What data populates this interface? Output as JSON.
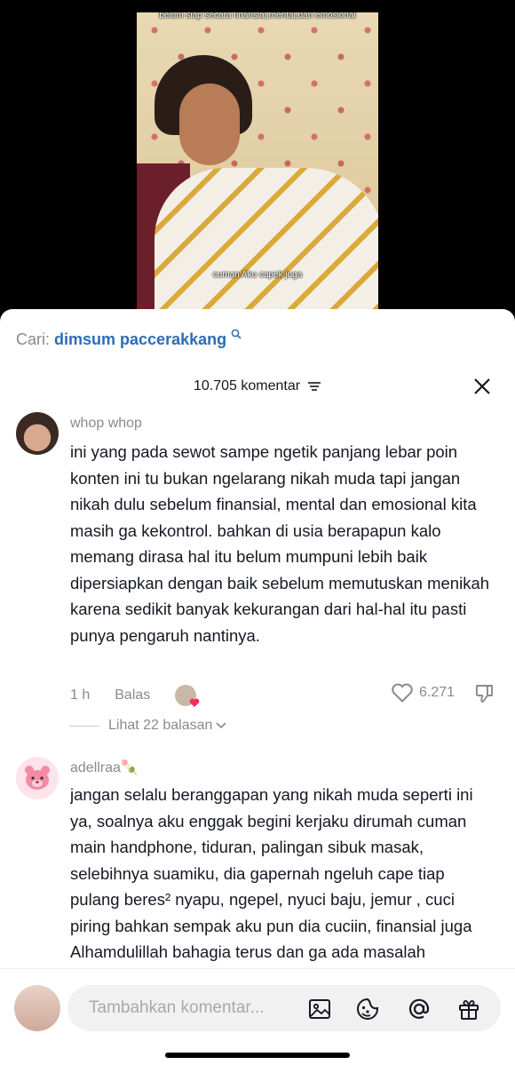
{
  "video": {
    "caption_top": "belum siap secara finansial,mental,dan emosional",
    "caption_bottom": "cuman Aku capek juga"
  },
  "search": {
    "prefix": "Cari: ",
    "term": "dimsum paccerakkang"
  },
  "header": {
    "count_label": "10.705 komentar"
  },
  "comments": [
    {
      "user": "whop whop",
      "text": "ini yang pada sewot sampe ngetik panjang lebar poin konten ini tu bukan ngelarang nikah muda tapi jangan nikah dulu sebelum finansial, mental dan emosional kita masih ga kekontrol. bahkan di usia berapapun kalo memang dirasa hal itu belum mumpuni lebih baik dipersiapkan dengan baik sebelum memutuskan menikah karena sedikit banyak kekurangan dari hal-hal itu pasti punya pengaruh nantinya.",
      "time": "1 h",
      "reply_label": "Balas",
      "likes": "6.271",
      "view_replies": "Lihat 22 balasan"
    },
    {
      "user": "adellraa🍡",
      "text": "jangan selalu beranggapan yang nikah muda seperti ini ya, soalnya aku enggak begini kerjaku dirumah cuman main handphone, tiduran, palingan sibuk masak, selebihnya suamiku, dia gapernah ngeluh cape tiap pulang beres² nyapu, ngepel, nyuci baju, jemur , cuci piring bahkan sempak aku pun dia cuciin, finansial juga Alhamdulillah bahagia terus dan ga ada masalah"
    }
  ],
  "input": {
    "placeholder": "Tambahkan komentar..."
  },
  "colors": {
    "link_blue": "#2d6db5",
    "text": "#161823",
    "muted": "#8a8a8a"
  }
}
